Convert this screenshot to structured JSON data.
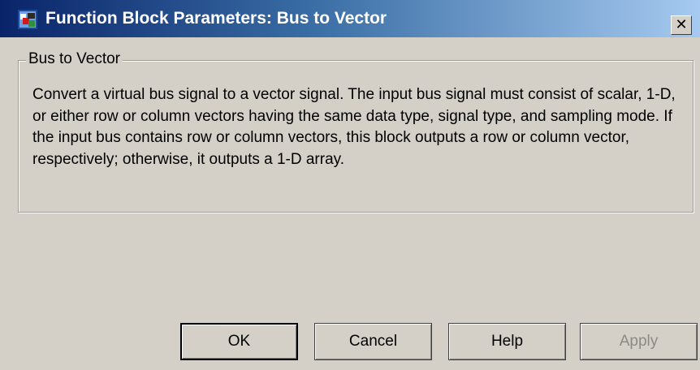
{
  "window": {
    "title": "Function Block Parameters: Bus to Vector",
    "close_label": "✕"
  },
  "group": {
    "label": "Bus to Vector",
    "description": "Convert a virtual bus signal to a vector signal. The input bus signal must consist of scalar, 1-D, or either row or column vectors having the same data type, signal type, and sampling mode. If the input bus contains row or column vectors, this block outputs a row or column vector, respectively; otherwise, it outputs a 1-D array."
  },
  "buttons": {
    "ok": "OK",
    "cancel": "Cancel",
    "help": "Help",
    "apply": "Apply",
    "apply_enabled": false
  },
  "colors": {
    "titlebar_start": "#0a246a",
    "titlebar_end": "#a6caf0",
    "face": "#d4d0c8",
    "disabled_text": "#8c8a84"
  },
  "icons": {
    "app": "simulink-block-icon",
    "close": "close-icon"
  }
}
